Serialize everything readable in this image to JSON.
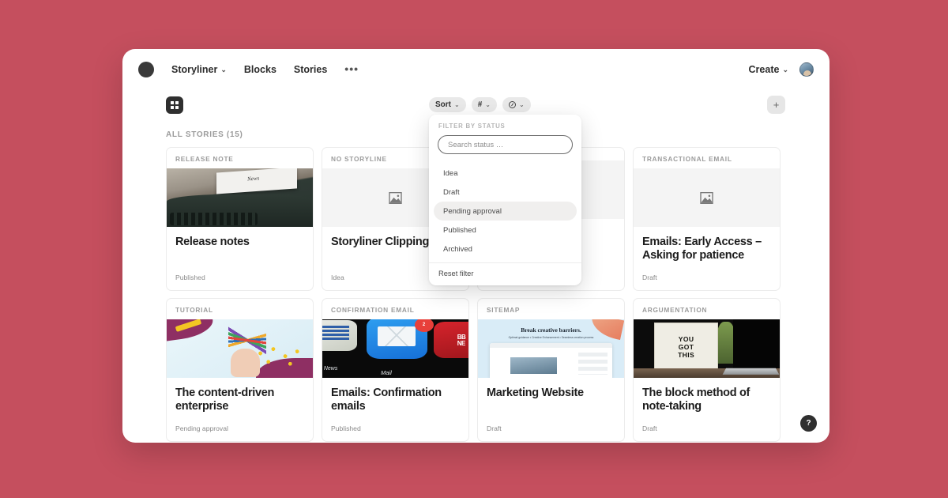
{
  "nav": {
    "logo": "logo-mark",
    "workspace": "Storyliner",
    "blocks": "Blocks",
    "stories": "Stories",
    "more": "•••",
    "create": "Create",
    "caret": "⌄"
  },
  "toolbar": {
    "grid_view": "grid-view",
    "sort_label": "Sort",
    "tag_label": "#",
    "status_label": "",
    "add_label": "+"
  },
  "section": {
    "label": "ALL STORIES (15)"
  },
  "dropdown": {
    "heading": "FILTER BY STATUS",
    "search_placeholder": "Search status …",
    "search_value": "",
    "options": [
      {
        "label": "Idea",
        "selected": false
      },
      {
        "label": "Draft",
        "selected": false
      },
      {
        "label": "Pending approval",
        "selected": true
      },
      {
        "label": "Published",
        "selected": false
      },
      {
        "label": "Archived",
        "selected": false
      }
    ],
    "reset": "Reset filter"
  },
  "cards": [
    {
      "kicker": "RELEASE NOTE",
      "title": "Release notes",
      "status": "Published",
      "thumb": "typewriter"
    },
    {
      "kicker": "NO STORYLINE",
      "title": "Storyliner Clipping",
      "status": "Idea",
      "thumb": "placeholder"
    },
    {
      "kicker": "",
      "title": "",
      "status": "",
      "thumb": "placeholder"
    },
    {
      "kicker": "TRANSACTIONAL EMAIL",
      "title": "Emails: Early Access – Asking for patience",
      "status": "Draft",
      "thumb": "placeholder"
    },
    {
      "kicker": "TUTORIAL",
      "title": "The content-driven enterprise",
      "status": "Pending approval",
      "thumb": "pencils"
    },
    {
      "kicker": "CONFIRMATION EMAIL",
      "title": "Emails: Confirmation emails",
      "status": "Published",
      "thumb": "mail"
    },
    {
      "kicker": "SITEMAP",
      "title": "Marketing Website",
      "status": "Draft",
      "thumb": "sitemap"
    },
    {
      "kicker": "ARGUMENTATION",
      "title": "The block method of note-taking",
      "status": "Draft",
      "thumb": "lightbox"
    }
  ],
  "thumb_text": {
    "news": "News",
    "sitemap_headline": "Break creative barriers.",
    "sitemap_sub": "Optimal guidance  •  Creative Enhancement  •  Seamless creation process",
    "mail_news": "News",
    "mail_mail": "Mail",
    "mail_badge": "2",
    "mail_bbc": "BB\nNE",
    "lightbox_1": "YOU",
    "lightbox_2": "GOT",
    "lightbox_3": "THIS"
  },
  "help": {
    "label": "?"
  },
  "colors": {
    "page_background": "#c54f5e",
    "window": "#ffffff",
    "accent_dark": "#2f2f2f",
    "pill": "#e9e9e9",
    "placeholder_bg": "#f4f4f4",
    "muted_text": "#9b9b9b"
  }
}
